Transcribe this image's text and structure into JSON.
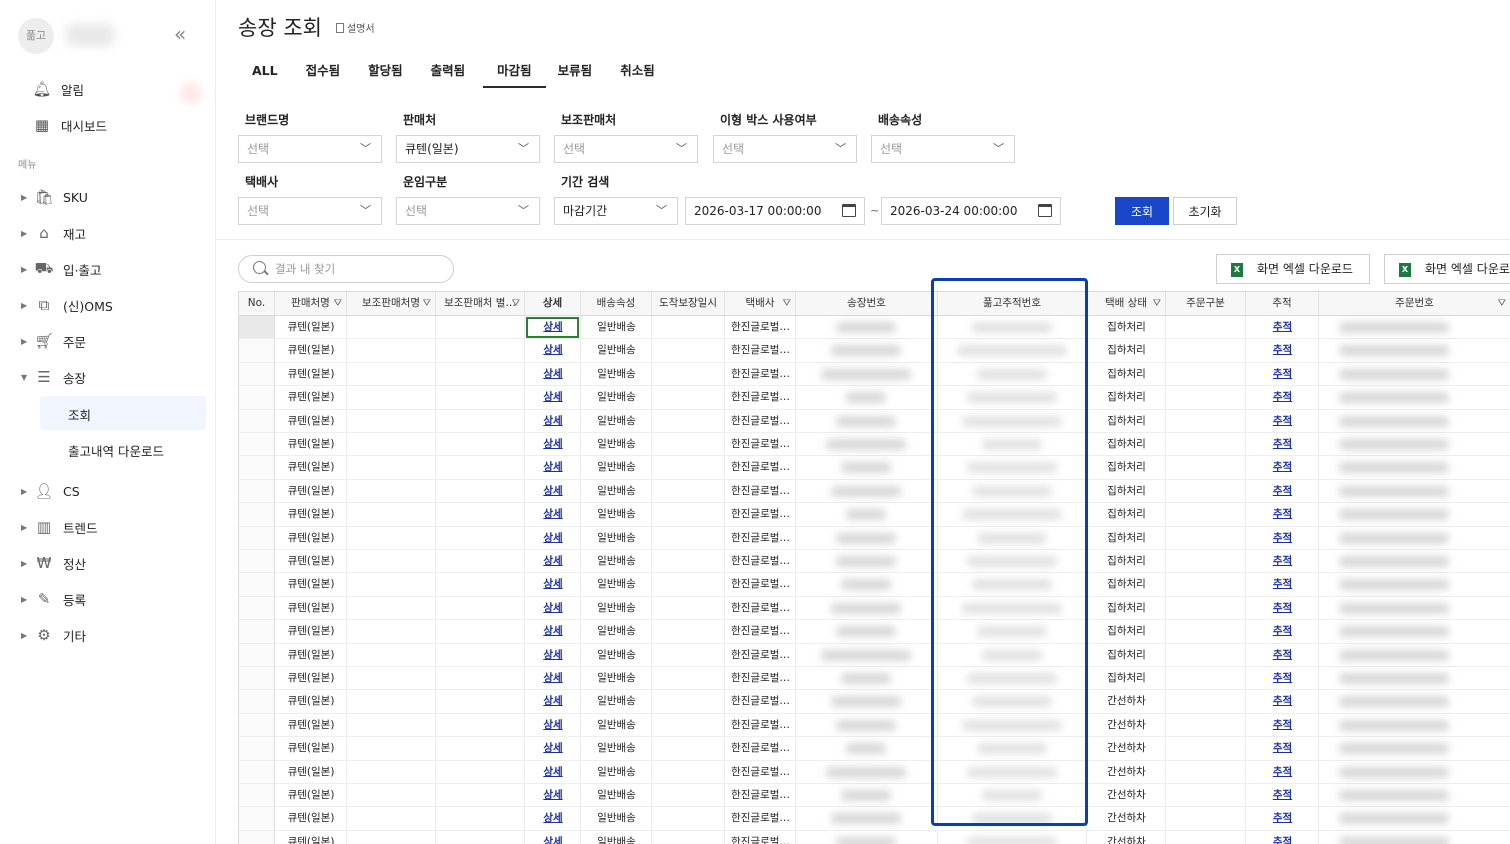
{
  "sidebar": {
    "avatar_text": "풂고",
    "items": [
      {
        "label": "알림",
        "icon": "bell-icon"
      },
      {
        "label": "대시보드",
        "icon": "dashboard-icon"
      }
    ],
    "section_label": "메뉴",
    "menu": [
      {
        "label": "SKU",
        "icon": "bag-icon"
      },
      {
        "label": "재고",
        "icon": "warehouse-icon"
      },
      {
        "label": "입·출고",
        "icon": "truck-icon"
      },
      {
        "label": "(신)OMS",
        "icon": "oms-icon"
      },
      {
        "label": "주문",
        "icon": "cart-icon"
      },
      {
        "label": "송장",
        "icon": "list-icon"
      },
      {
        "label": "CS",
        "icon": "user-icon"
      },
      {
        "label": "트렌드",
        "icon": "chart-icon"
      },
      {
        "label": "정산",
        "icon": "won-icon"
      },
      {
        "label": "등록",
        "icon": "pencil-icon"
      },
      {
        "label": "기타",
        "icon": "gear-icon"
      }
    ],
    "submenu": [
      "조회",
      "출고내역 다운로드"
    ]
  },
  "page": {
    "title": "송장 조회",
    "manual_label": "설명서"
  },
  "tabs": [
    "ALL",
    "접수됨",
    "할당됨",
    "출력됨",
    "마감됨",
    "보류됨",
    "취소됨"
  ],
  "active_tab": "마감됨",
  "filters": {
    "brand": {
      "label": "브랜드명",
      "value": "선택"
    },
    "seller": {
      "label": "판매처",
      "value": "큐텐(일본)"
    },
    "sub_seller": {
      "label": "보조판매처",
      "value": "선택"
    },
    "box": {
      "label": "이형 박스 사용여부",
      "value": "선택"
    },
    "delivery_attr": {
      "label": "배송속성",
      "value": "선택"
    },
    "courier": {
      "label": "택배사",
      "value": "선택"
    },
    "freight": {
      "label": "운임구분",
      "value": "선택"
    },
    "period": {
      "label": "기간 검색",
      "value": "마감기간"
    },
    "date_from": "2026-03-17 00:00:00",
    "date_to": "2026-03-24 00:00:00",
    "tilde": "~",
    "search_button": "조회",
    "reset_button": "초기화"
  },
  "result_search_placeholder": "결과 내 찾기",
  "excel_buttons": [
    "화면 엑셀 다운로드",
    "화면 엑셀 다운로드"
  ],
  "grid": {
    "columns": [
      "No.",
      "판매처명",
      "보조판매처명",
      "보조판매처 별…",
      "상세",
      "배송속성",
      "도착보장일시",
      "택배사",
      "송장번호",
      "풂고추적번호",
      "택배 상태",
      "주문구분",
      "추적",
      "주문번호"
    ],
    "row_template": {
      "seller": "큐텐(일본)",
      "detail": "상세",
      "delivery": "일반배송",
      "courier": "한진글로벌…",
      "track": "추적"
    },
    "statuses": [
      "집하처리",
      "집하처리",
      "집하처리",
      "집하처리",
      "집하처리",
      "집하처리",
      "집하처리",
      "집하처리",
      "집하처리",
      "집하처리",
      "집하처리",
      "집하처리",
      "집하처리",
      "집하처리",
      "집하처리",
      "집하처리",
      "간선하차",
      "간선하차",
      "간선하차",
      "간선하차",
      "간선하차",
      "간선하차",
      "간선하차"
    ]
  },
  "colors": {
    "primary": "#1a47c9",
    "link": "#1a2fa8",
    "highlight": "#0a3fb0",
    "excel": "#1e7a44"
  }
}
